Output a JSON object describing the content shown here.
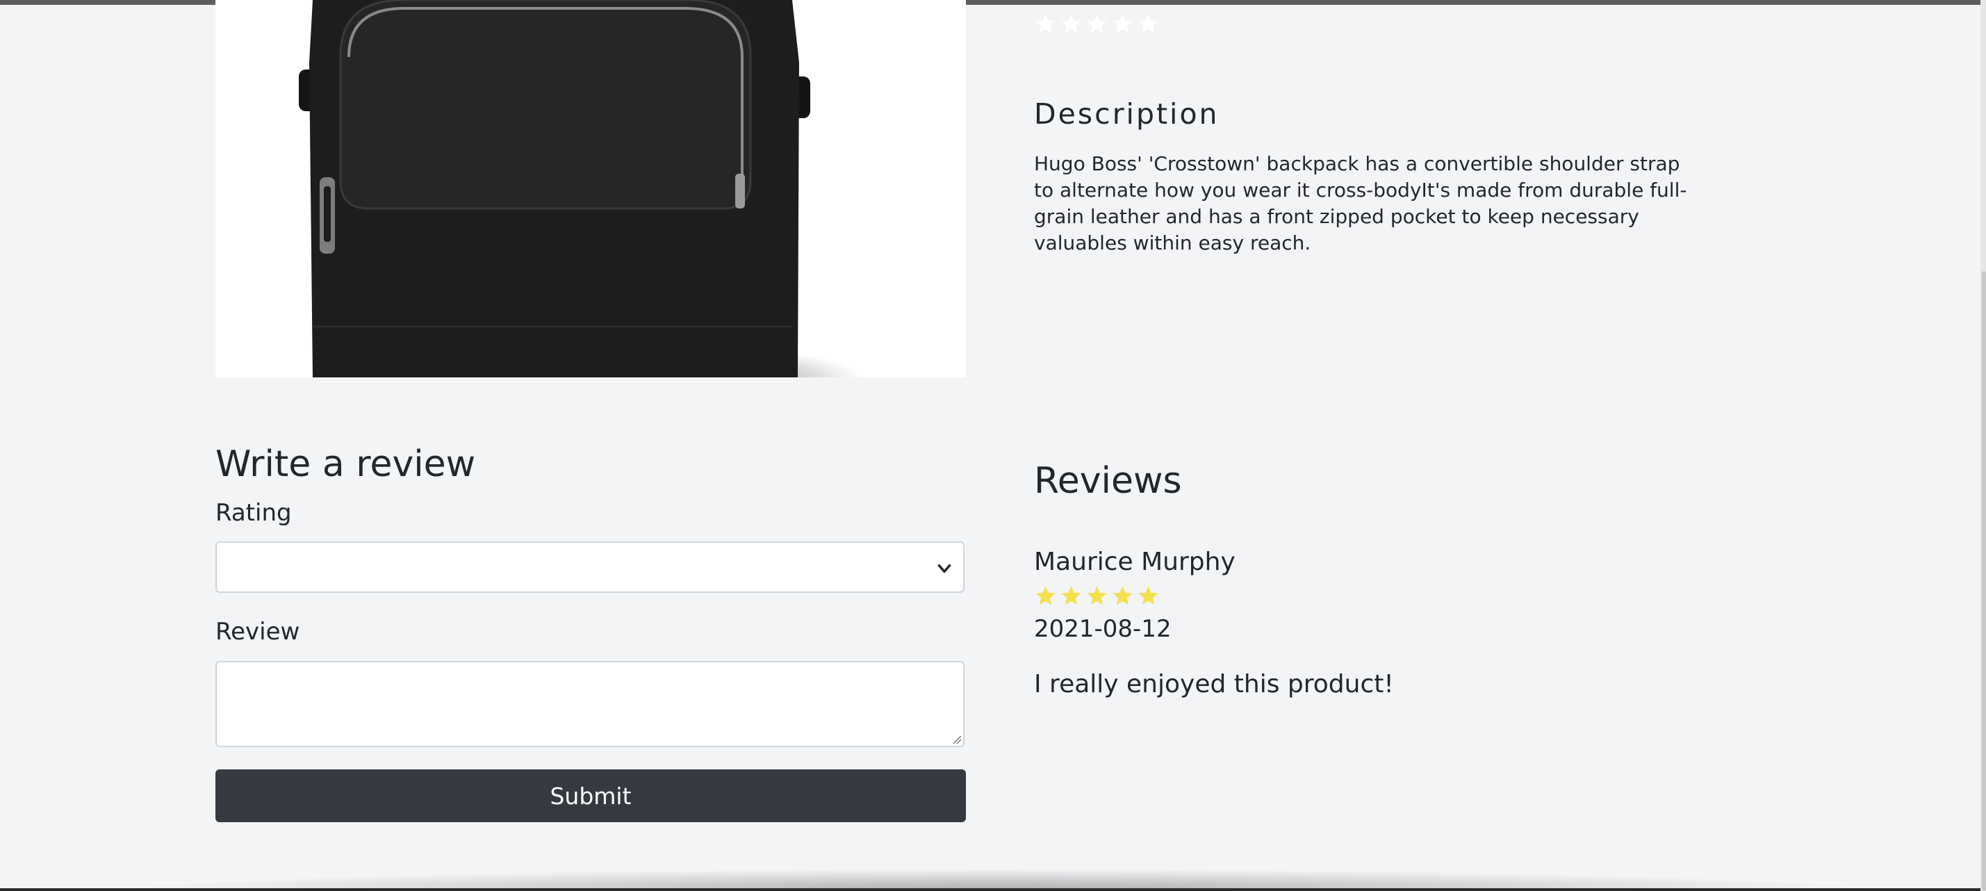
{
  "product": {
    "image_alt": "Black leather backpack",
    "rating_stars_filled": 0,
    "rating_stars_total": 5,
    "rating_star_color": "#ffffff"
  },
  "description": {
    "heading": "Description",
    "text": "Hugo Boss' 'Crosstown' backpack has a convertible shoulder strap to alternate how you wear it cross-bodyIt's made from durable full-grain leather and has a front zipped pocket to keep necessary valuables within easy reach."
  },
  "review_form": {
    "heading": "Write a review",
    "rating_label": "Rating",
    "rating_selected": "",
    "review_label": "Review",
    "review_value": "",
    "submit_label": "Submit",
    "submit_color": "#343a40"
  },
  "reviews": {
    "heading": "Reviews",
    "items": [
      {
        "name": "Maurice Murphy",
        "stars_filled": 5,
        "date": "2021-08-12",
        "comment": "I really enjoyed this product!"
      }
    ],
    "star_color": "#f4e04d"
  },
  "icons": {
    "star": "star-icon",
    "select_chevron": "chevron-down-icon",
    "resize_grip": "resize-grip-icon"
  }
}
